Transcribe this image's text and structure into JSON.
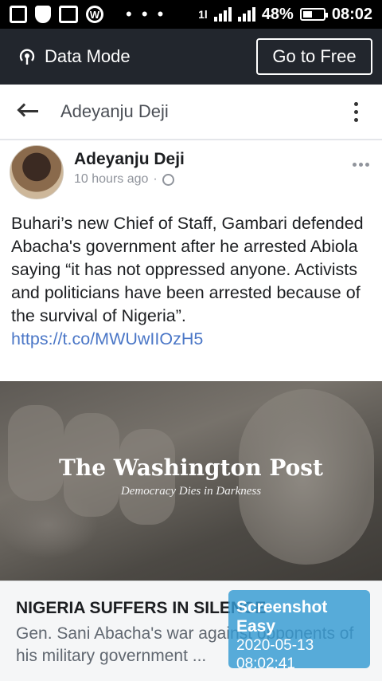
{
  "status_bar": {
    "left_icons": [
      "news-icon",
      "shield-icon",
      "gmail-icon",
      "wordpress-icon"
    ],
    "dots": "• • •",
    "network_label": "1l",
    "battery_percent": "48%",
    "battery_level": 0.48,
    "time": "08:02"
  },
  "data_mode": {
    "label": "Data Mode",
    "go_free_label": "Go to Free"
  },
  "header": {
    "title": "Adeyanju Deji"
  },
  "post": {
    "author": "Adeyanju Deji",
    "time": "10 hours ago",
    "separator": "·",
    "text": "Buhari’s new Chief of Staff, Gambari defended Abacha's government after he arrested Abiola saying “it has not oppressed anyone. Activists and politicians have been arrested because of the survival of Nigeria”. ",
    "link": "https://t.co/MWUwIIOzH5"
  },
  "preview": {
    "brand": "The Washington Post",
    "tagline": "Democracy Dies in Darkness"
  },
  "link_card": {
    "title": "NIGERIA SUFFERS IN SILENCE",
    "description": "Gen. Sani Abacha's war against opponents of his military government ..."
  },
  "overlay": {
    "title": "Screenshot Easy",
    "date": "2020-05-13",
    "time": "08:02:41"
  }
}
